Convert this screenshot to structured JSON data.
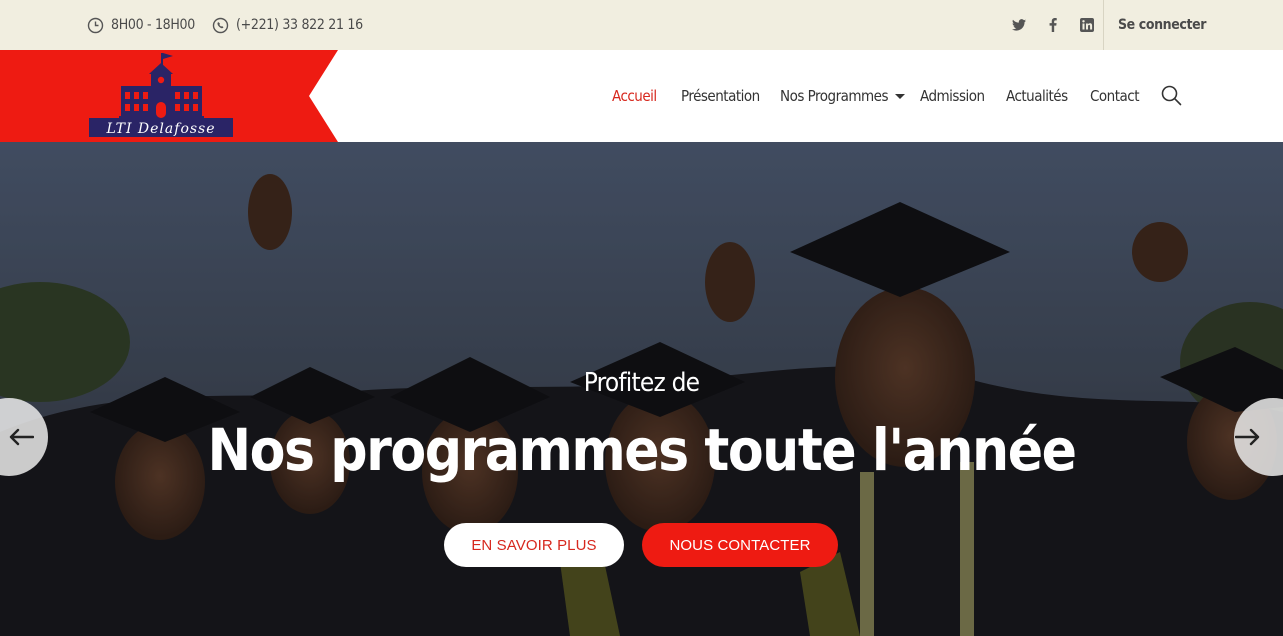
{
  "topbar": {
    "hours": "8H00 - 18H00",
    "phone": "(+221) 33 822 21 16",
    "socials": [
      "twitter-icon",
      "facebook-icon",
      "linkedin-icon"
    ],
    "login_label": "Se connecter"
  },
  "logo": {
    "text": "LTI Delafosse",
    "colors": {
      "panel": "#ee1b12",
      "building": "#2a2466"
    }
  },
  "nav": {
    "items": [
      {
        "label": "Accueil",
        "active": true
      },
      {
        "label": "Présentation"
      },
      {
        "label": "Nos Programmes",
        "dropdown": true
      },
      {
        "label": "Admission"
      },
      {
        "label": "Actualités"
      },
      {
        "label": "Contact"
      }
    ],
    "search_icon": "search-icon"
  },
  "hero": {
    "subtitle": "Profitez de",
    "title": "Nos programmes toute l'année",
    "buttons": {
      "more": "EN SAVOIR PLUS",
      "contact": "NOUS CONTACTER"
    },
    "arrows": [
      "arrow-left-icon",
      "arrow-right-icon"
    ]
  },
  "colors": {
    "accent": "#d7281e",
    "button_red": "#ee1b12",
    "topbar_bg": "#f1eee0"
  }
}
